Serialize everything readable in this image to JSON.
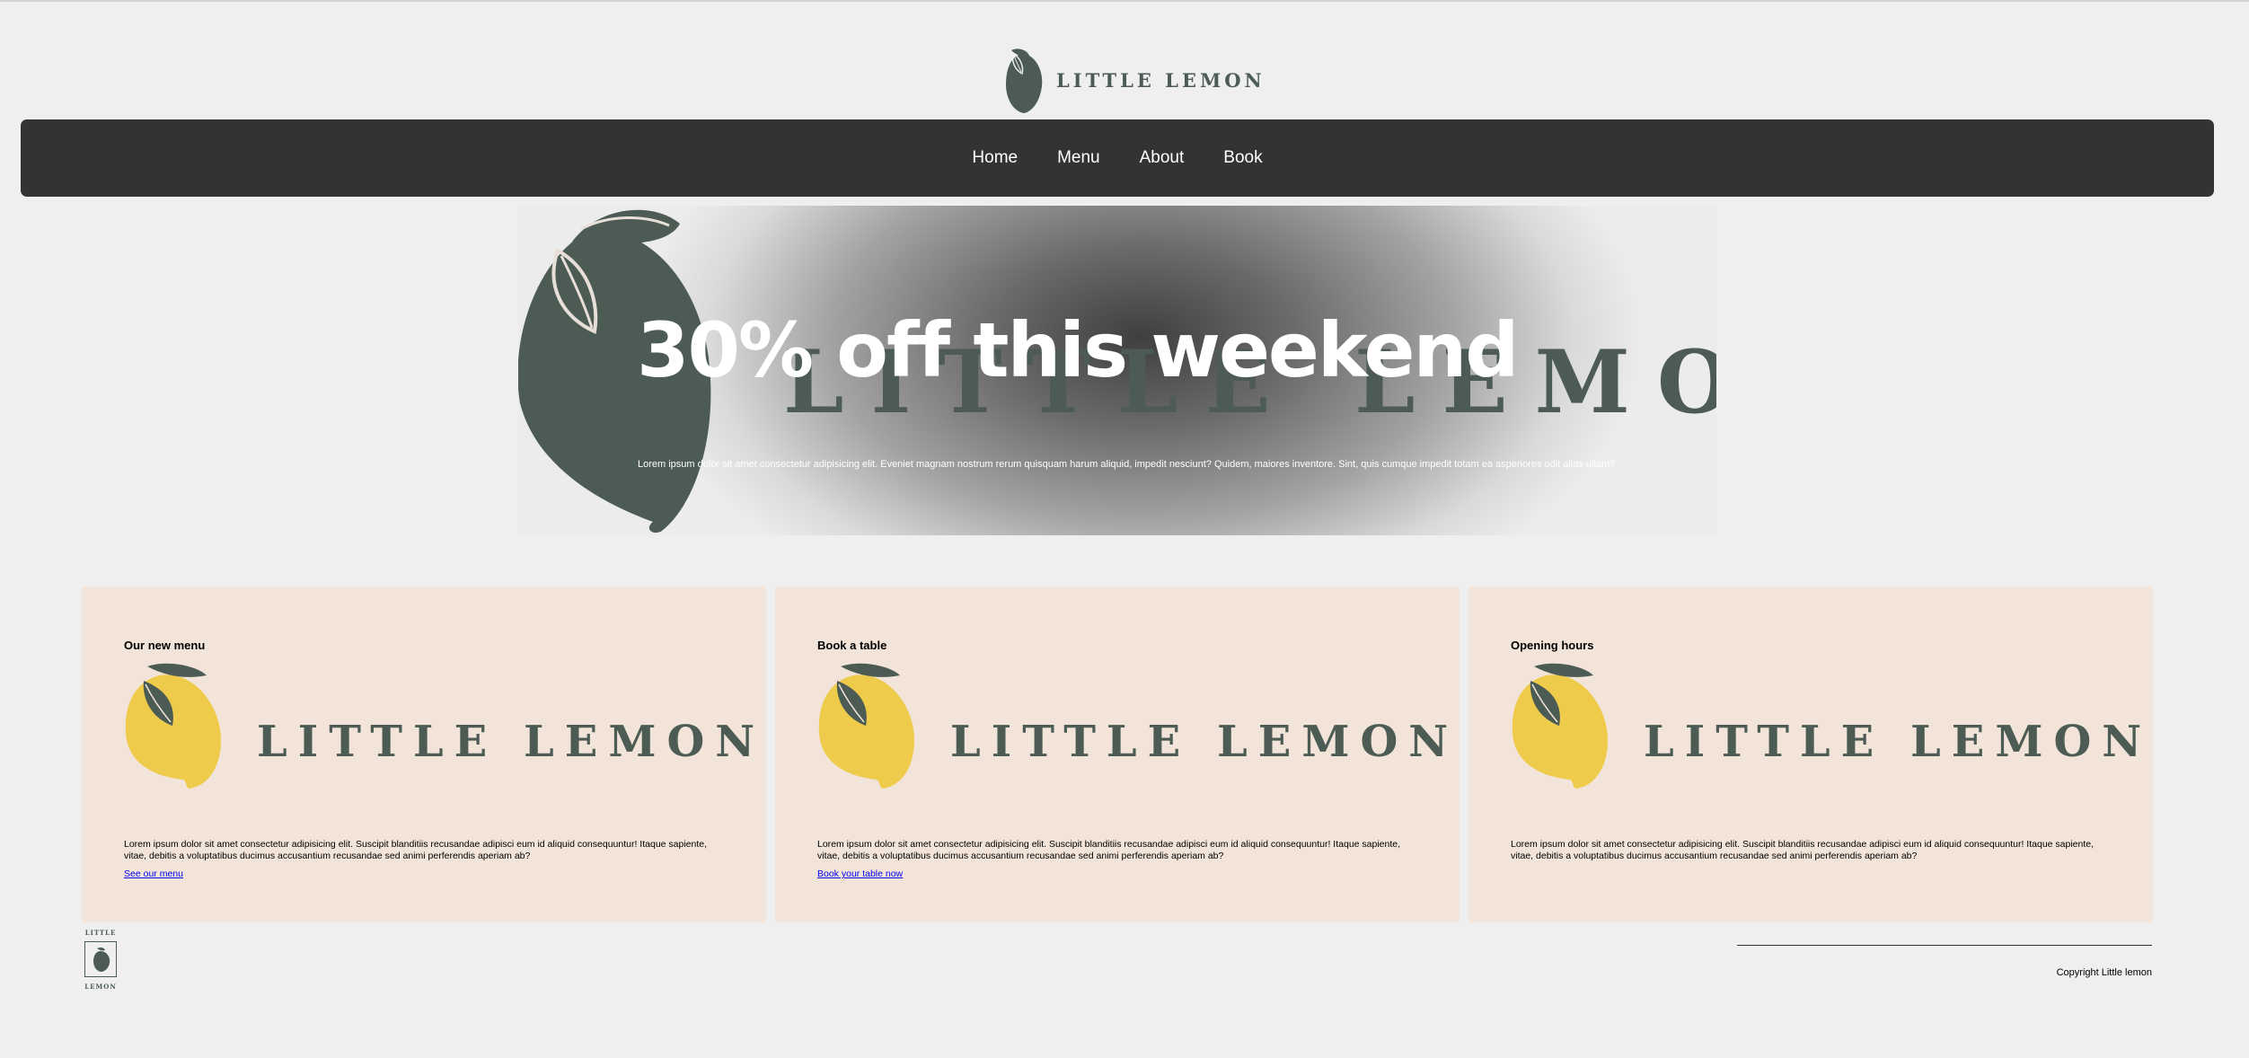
{
  "header": {
    "logo_text": "LITTLE LEMON"
  },
  "nav": {
    "items": [
      "Home",
      "Menu",
      "About",
      "Book"
    ]
  },
  "hero": {
    "title": "30% off this weekend",
    "background_brand": "LITTLE LEMON",
    "text": "Lorem ipsum dolor sit amet consectetur adipisicing elit. Eveniet magnam nostrum rerum quisquam harum aliquid, impedit nesciunt? Quidem, maiores inventore. Sint, quis cumque impedit totam ea asperiores odit alias ullam?"
  },
  "cards": [
    {
      "title": "Our new menu",
      "brand": "LITTLE LEMON",
      "text": "Lorem ipsum dolor sit amet consectetur adipisicing elit. Suscipit blanditiis recusandae adipisci eum id aliquid consequuntur! Itaque sapiente, vitae, debitis a voluptatibus ducimus accusantium recusandae sed animi perferendis aperiam ab?",
      "link": "See our menu"
    },
    {
      "title": "Book a table",
      "brand": "LITTLE LEMON",
      "text": "Lorem ipsum dolor sit amet consectetur adipisicing elit. Suscipit blanditiis recusandae adipisci eum id aliquid consequuntur! Itaque sapiente, vitae, debitis a voluptatibus ducimus accusantium recusandae sed animi perferendis aperiam ab?",
      "link": "Book your table now"
    },
    {
      "title": "Opening hours",
      "brand": "LITTLE LEMON",
      "text": "Lorem ipsum dolor sit amet consectetur adipisicing elit. Suscipit blanditiis recusandae adipisci eum id aliquid consequuntur! Itaque sapiente, vitae, debitis a voluptatibus ducimus accusantium recusandae sed animi perferendis aperiam ab?"
    }
  ],
  "footer": {
    "logo_top": "LITTLE",
    "logo_bottom": "LEMON",
    "copyright": "Copyright Little lemon"
  },
  "colors": {
    "brand_green": "#4c5c54",
    "lemon_yellow": "#eecb4a",
    "nav_bg": "#333333",
    "card_bg": "#f2e4d8",
    "page_bg": "#efefef"
  },
  "icons": [
    "lemon-logo-icon",
    "lemon-illustration-icon"
  ]
}
